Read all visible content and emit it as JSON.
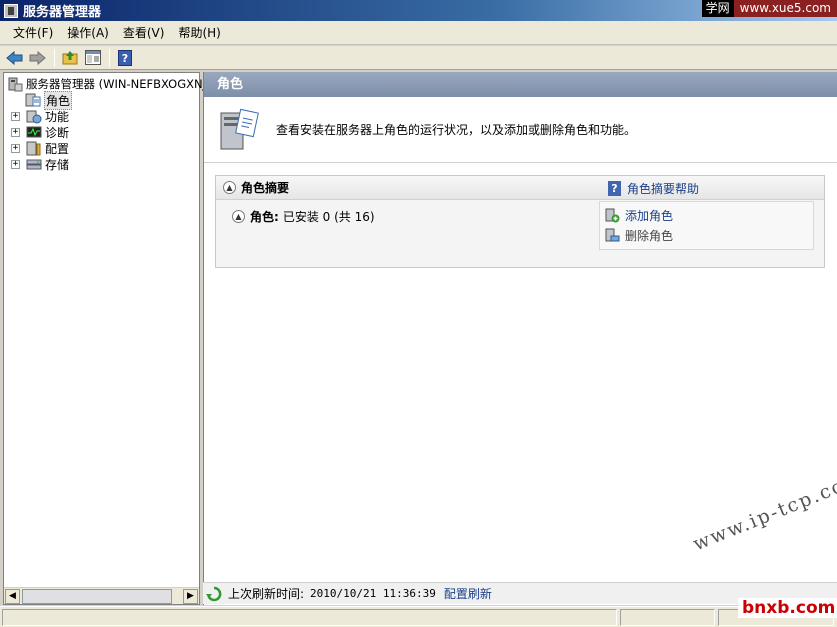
{
  "window": {
    "title": "服务器管理器"
  },
  "watermark": {
    "top_left": "学网",
    "top_right": "www.xue5.com",
    "diagonal": "www.ip-tcp.com",
    "bottom": "bnxb.com"
  },
  "menu": [
    {
      "label": "文件(F)"
    },
    {
      "label": "操作(A)"
    },
    {
      "label": "查看(V)"
    },
    {
      "label": "帮助(H)"
    }
  ],
  "toolbar": {
    "icons": [
      "back-icon",
      "forward-icon",
      "up-folder-icon",
      "show-hide-tree-icon",
      "help-icon"
    ]
  },
  "tree": {
    "root": "服务器管理器 (WIN-NEFBXOGXNJ",
    "items": [
      {
        "label": "角色",
        "icon": "roles-icon",
        "selected": true,
        "expander": ""
      },
      {
        "label": "功能",
        "icon": "features-icon",
        "expander": "+"
      },
      {
        "label": "诊断",
        "icon": "diagnostics-icon",
        "expander": "+"
      },
      {
        "label": "配置",
        "icon": "configuration-icon",
        "expander": "+"
      },
      {
        "label": "存储",
        "icon": "storage-icon",
        "expander": "+"
      }
    ]
  },
  "main": {
    "header": "角色",
    "description": "查看安装在服务器上角色的运行状况，以及添加或删除角色和功能。",
    "summary": {
      "title": "角色摘要",
      "help_link": "角色摘要帮助",
      "roles_label": "角色:",
      "roles_status": "已安装 0 (共 16)",
      "actions": {
        "add": "添加角色",
        "remove": "删除角色"
      }
    },
    "refresh": {
      "label": "上次刷新时间:",
      "time": "2010/10/21 11:36:39",
      "link": "配置刷新"
    }
  },
  "colors": {
    "title_bar": "#0a246a",
    "header": "#8a9bb5",
    "link": "#1a3f8a"
  }
}
